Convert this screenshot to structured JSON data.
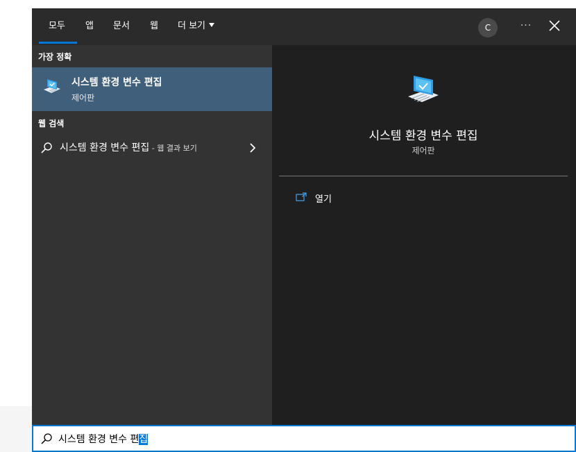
{
  "tabs": [
    {
      "label": "모두"
    },
    {
      "label": "앱"
    },
    {
      "label": "문서"
    },
    {
      "label": "웹"
    },
    {
      "label": "더 보기"
    }
  ],
  "account": {
    "initial": "C"
  },
  "more_options": "···",
  "left": {
    "best_match_label": "가장 정확",
    "best_match": {
      "title": "시스템 환경 변수 편집",
      "subtitle": "제어판",
      "icon": "monitor-settings-icon"
    },
    "web_label": "웹 검색",
    "web_result": {
      "query": "시스템 환경 변수 편집",
      "suffix": " - 웹 결과 보기"
    }
  },
  "detail": {
    "title": "시스템 환경 변수 편집",
    "subtitle": "제어판",
    "actions": [
      {
        "label": "열기",
        "icon": "open-window-icon"
      }
    ]
  },
  "search": {
    "typed": "시스템 환경 변수 편",
    "selected": "집"
  },
  "colors": {
    "accent": "#0078d7",
    "selection": "#3f5f7b"
  }
}
